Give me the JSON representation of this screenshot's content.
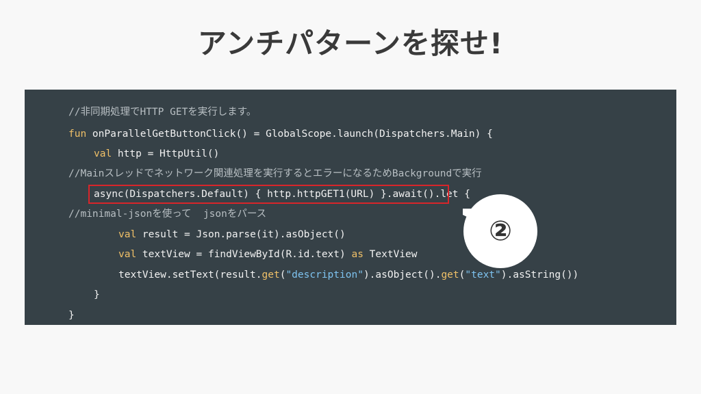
{
  "title": "アンチパターンを探せ!",
  "callout": {
    "label": "②"
  },
  "code": {
    "line1": "//非同期処理でHTTP GETを実行します。",
    "line2_kw": "fun",
    "line2_rest": " onParallelGetButtonClick() = GlobalScope.launch(Dispatchers.Main) {",
    "line3_kw": "val",
    "line3_rest": " http = HttpUtil()",
    "line4": "//Mainスレッドでネットワーク関連処理を実行するとエラーになるためBackgroundで実行",
    "line5": "async(Dispatchers.Default) { http.httpGET1(URL) }.await().let {",
    "line6": "//minimal-jsonを使って  jsonをパース",
    "line7_kw": "val",
    "line7_rest": " result = Json.parse(it).asObject()",
    "line8_kw": "val",
    "line8_mid": " textView = findViewById(R.id.text) ",
    "line8_kw2": "as",
    "line8_rest": " TextView",
    "line9_a": "textView.setText(result.",
    "line9_get1": "get",
    "line9_b": "(",
    "line9_str1": "\"description\"",
    "line9_c": ").asObject().",
    "line9_get2": "get",
    "line9_d": "(",
    "line9_str2": "\"text\"",
    "line9_e": ").asString())",
    "line10": "}",
    "line11": "}"
  }
}
